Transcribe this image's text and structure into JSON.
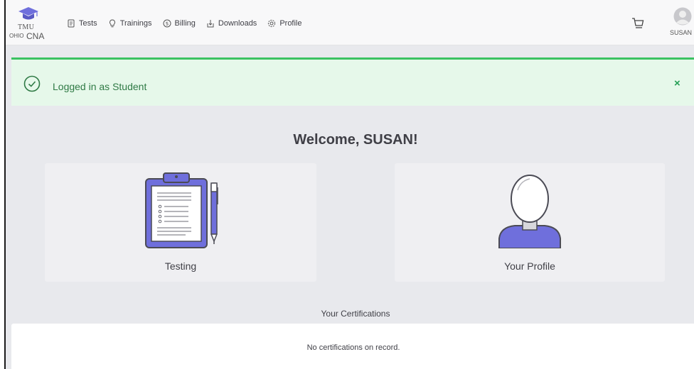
{
  "brand": {
    "line1": "TMU",
    "state": "OHIO",
    "program": "CNA"
  },
  "nav": {
    "items": [
      {
        "label": "Tests",
        "icon": "document-icon"
      },
      {
        "label": "Trainings",
        "icon": "lightbulb-icon"
      },
      {
        "label": "Billing",
        "icon": "dollar-icon"
      },
      {
        "label": "Downloads",
        "icon": "download-icon"
      },
      {
        "label": "Profile",
        "icon": "gear-icon"
      }
    ],
    "cart_icon": "cart-icon",
    "user_name": "SUSAN"
  },
  "alert": {
    "message": "Logged in as Student",
    "close_label": "×",
    "color": "#3bc262"
  },
  "main": {
    "welcome": "Welcome, SUSAN!",
    "cards": [
      {
        "label": "Testing",
        "icon": "clipboard-icon"
      },
      {
        "label": "Your Profile",
        "icon": "person-icon"
      }
    ],
    "certifications_title": "Your Certifications",
    "certifications_empty": "No certifications on record."
  },
  "colors": {
    "accent": "#6f6fdc",
    "success": "#3bc262",
    "background": "#e8e9ed"
  }
}
